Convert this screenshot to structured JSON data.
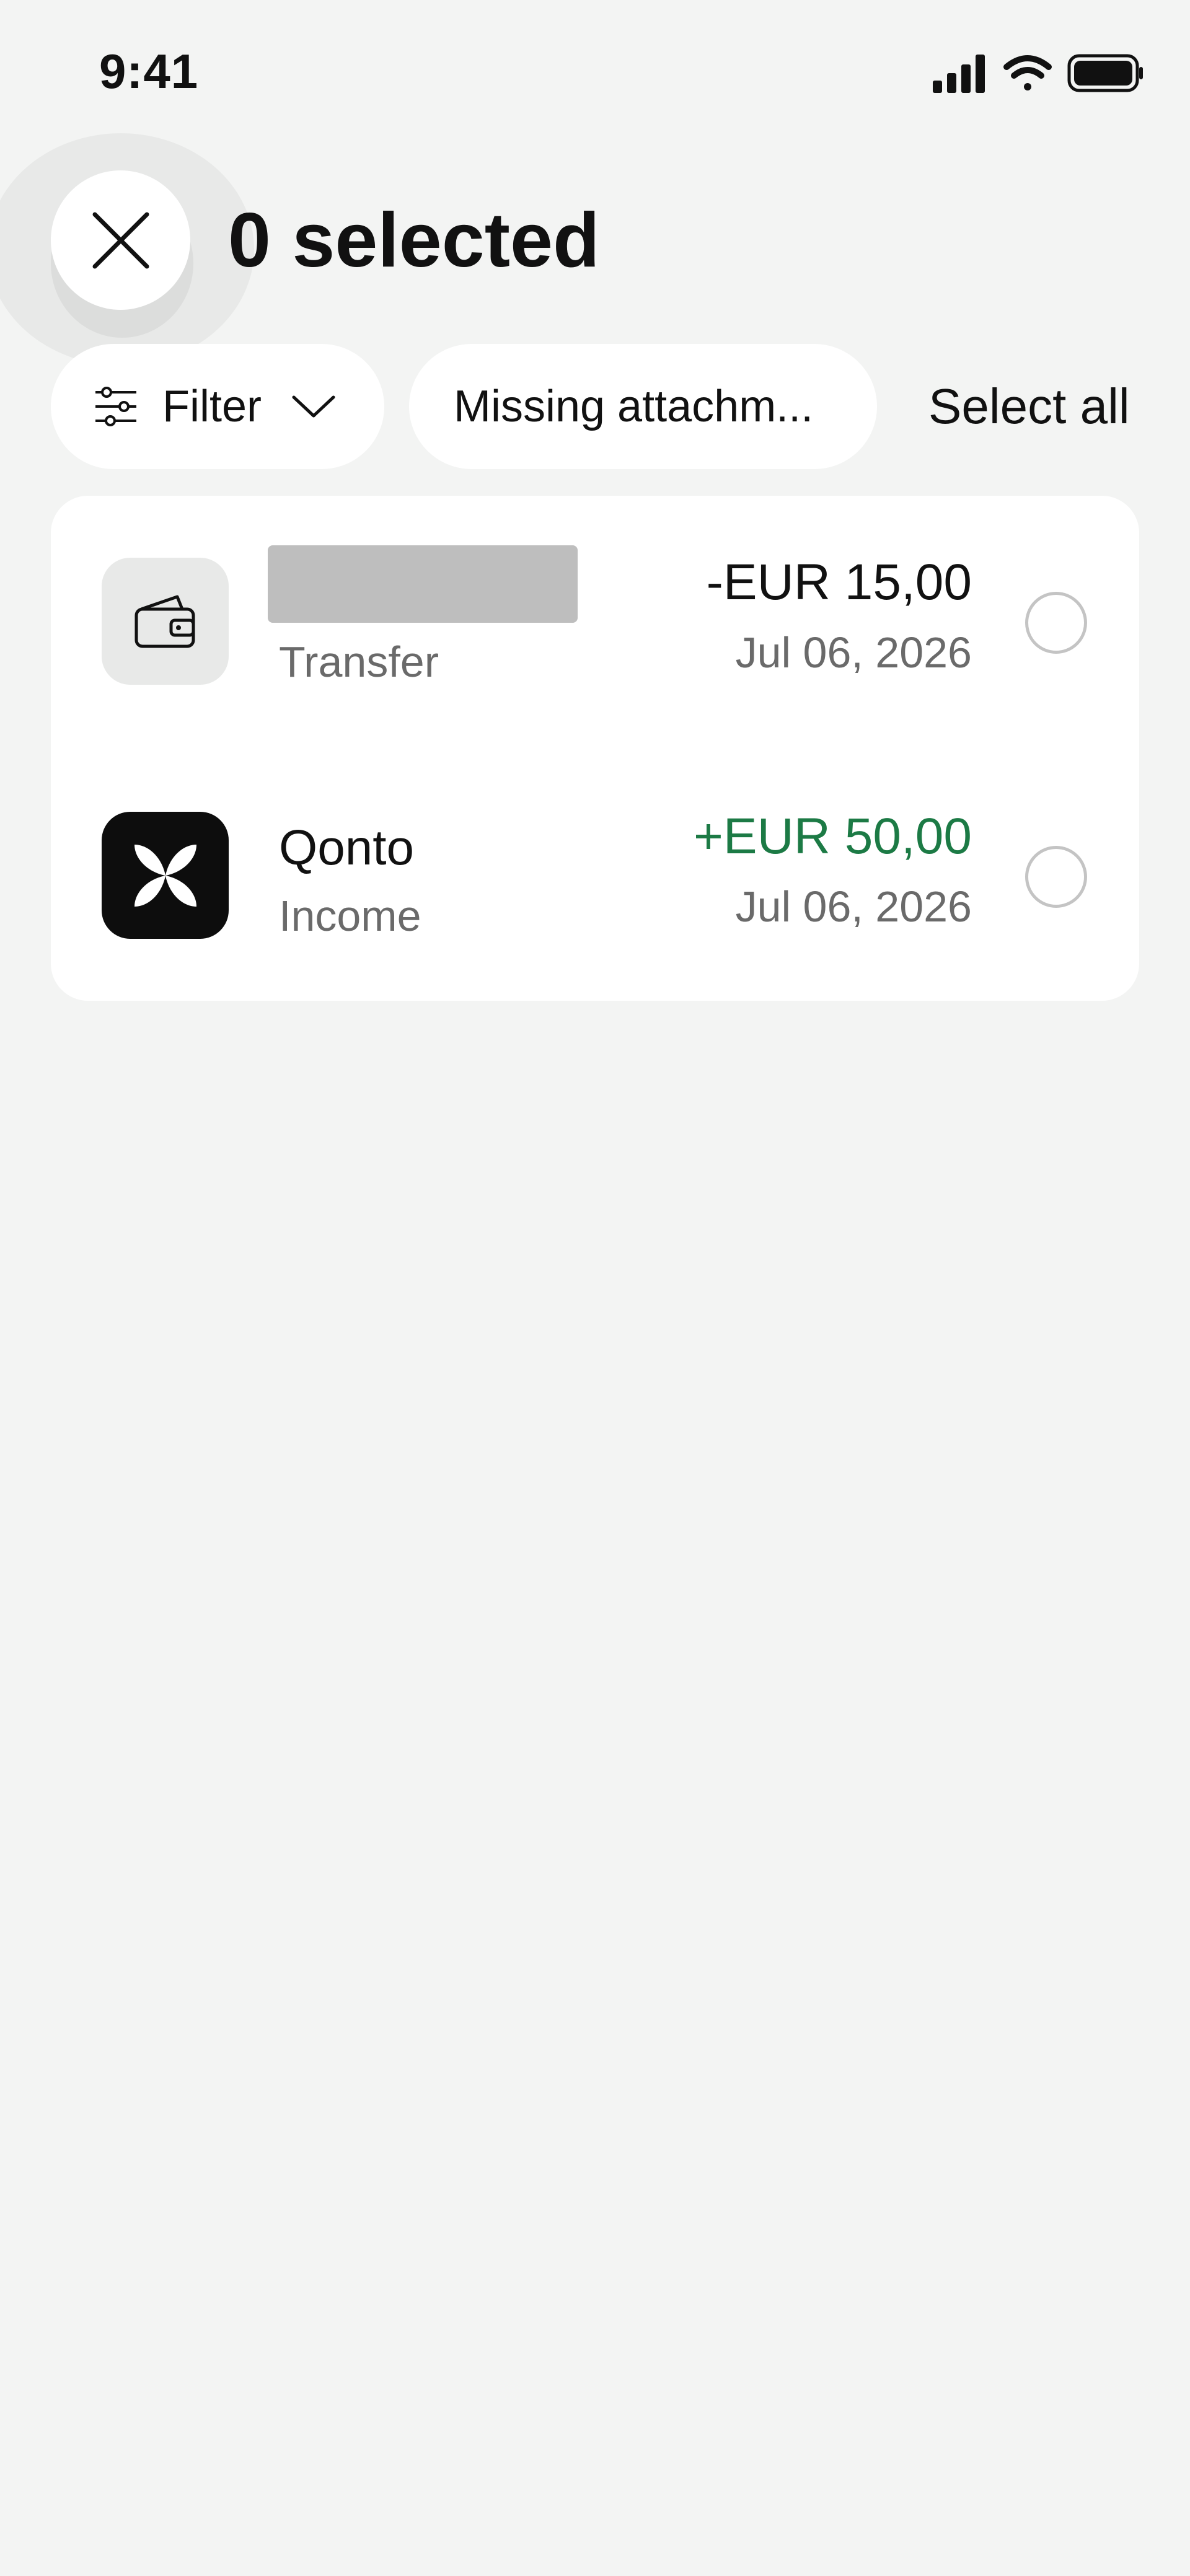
{
  "status_bar": {
    "time": "9:41",
    "icons": [
      "cellular-signal-icon",
      "wifi-icon",
      "battery-icon"
    ]
  },
  "header": {
    "close_icon": "close-icon",
    "title": "0 selected"
  },
  "filters": {
    "filter_chip": {
      "icon": "sliders-icon",
      "label": "Filter",
      "chevron": "chevron-down-icon"
    },
    "missing_chip": {
      "label": "Missing attachm..."
    },
    "select_all": "Select all"
  },
  "transactions": [
    {
      "icon": "wallet-icon",
      "name": "",
      "name_redacted": true,
      "type": "Transfer",
      "amount": "-EUR 15,00",
      "date": "Jul 06, 2026",
      "selected": false
    },
    {
      "icon": "qonto-logo-icon",
      "name": "Qonto",
      "name_redacted": false,
      "type": "Income",
      "amount": "+EUR 50,00",
      "date": "Jul 06, 2026",
      "selected": false
    }
  ],
  "colors": {
    "background": "#f3f4f3",
    "card": "#ffffff",
    "positive_amount": "#1c7a45",
    "secondary_text": "#6a6a6a",
    "redaction": "#bebebe"
  }
}
